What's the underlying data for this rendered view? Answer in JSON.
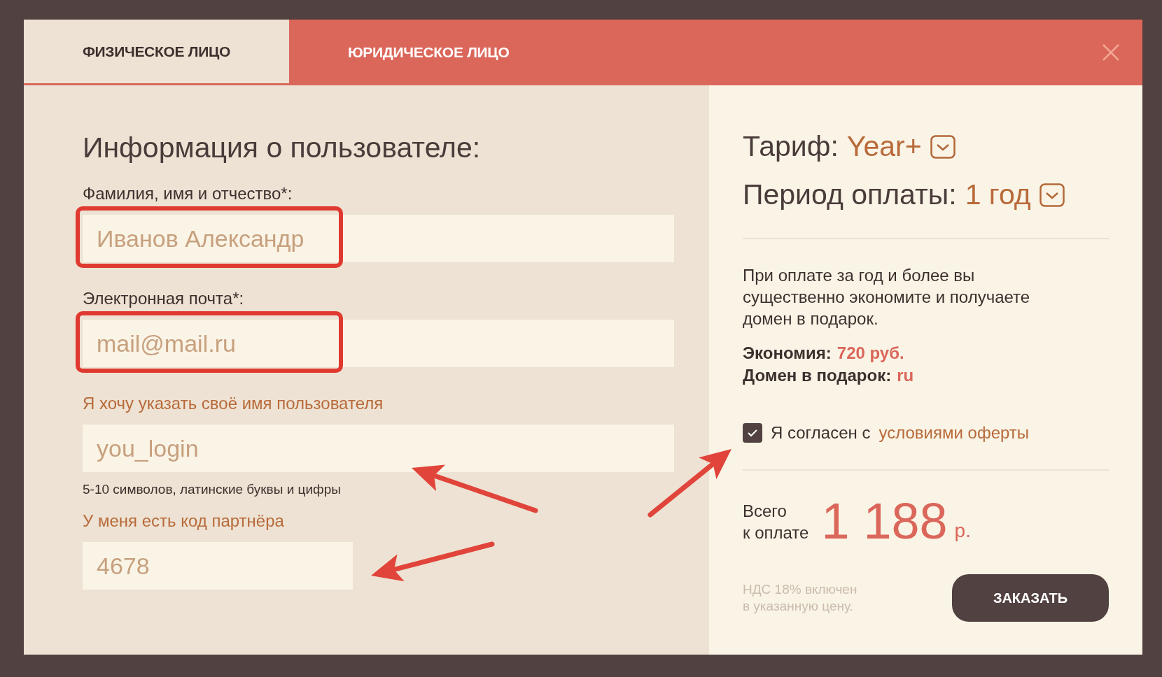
{
  "tabs": [
    {
      "label": "ФИЗИЧЕСКОЕ ЛИЦО",
      "selected": true
    },
    {
      "label": "ЮРИДИЧЕСКОЕ ЛИЦО",
      "selected": false
    }
  ],
  "form": {
    "title": "Информация о пользователе:",
    "fields": [
      {
        "kind": "labeled",
        "label": "Фамилия, имя и отчество*:",
        "placeholder": "Иванов Александр",
        "highlighted": true,
        "arrow": false
      },
      {
        "kind": "labeled",
        "label": "Электронная почта*:",
        "placeholder": "mail@mail.ru",
        "highlighted": true,
        "arrow": false
      },
      {
        "kind": "link",
        "label": "Я хочу указать своё имя пользователя",
        "placeholder": "you_login",
        "hint": "5-10 символов, латинские буквы и цифры",
        "highlighted": false,
        "arrow": true
      },
      {
        "kind": "link",
        "label": "У меня есть код партнёра",
        "placeholder": "4678",
        "highlighted": false,
        "arrow": true
      }
    ]
  },
  "order": {
    "tariff_label": "Тариф:",
    "tariff": "Year+",
    "period_label": "Период оплаты:",
    "period": "1 год",
    "description": "При оплате за год и более вы существенно экономите и получаете домен в подарок.",
    "savings_label": "Экономия:",
    "savings": "720 руб.",
    "gift_label": "Домен в подарок:",
    "gift": "ru",
    "agree": {
      "checked": true,
      "arrow": true,
      "text": "Я согласен с",
      "link": "условиями оферты"
    },
    "total_label": [
      "Всего",
      "к оплате"
    ],
    "total": "1 188",
    "currency": "р.",
    "vat_note": [
      "НДС 18% включен",
      "в указанную цену."
    ],
    "button": "ЗАКАЗАТЬ"
  }
}
